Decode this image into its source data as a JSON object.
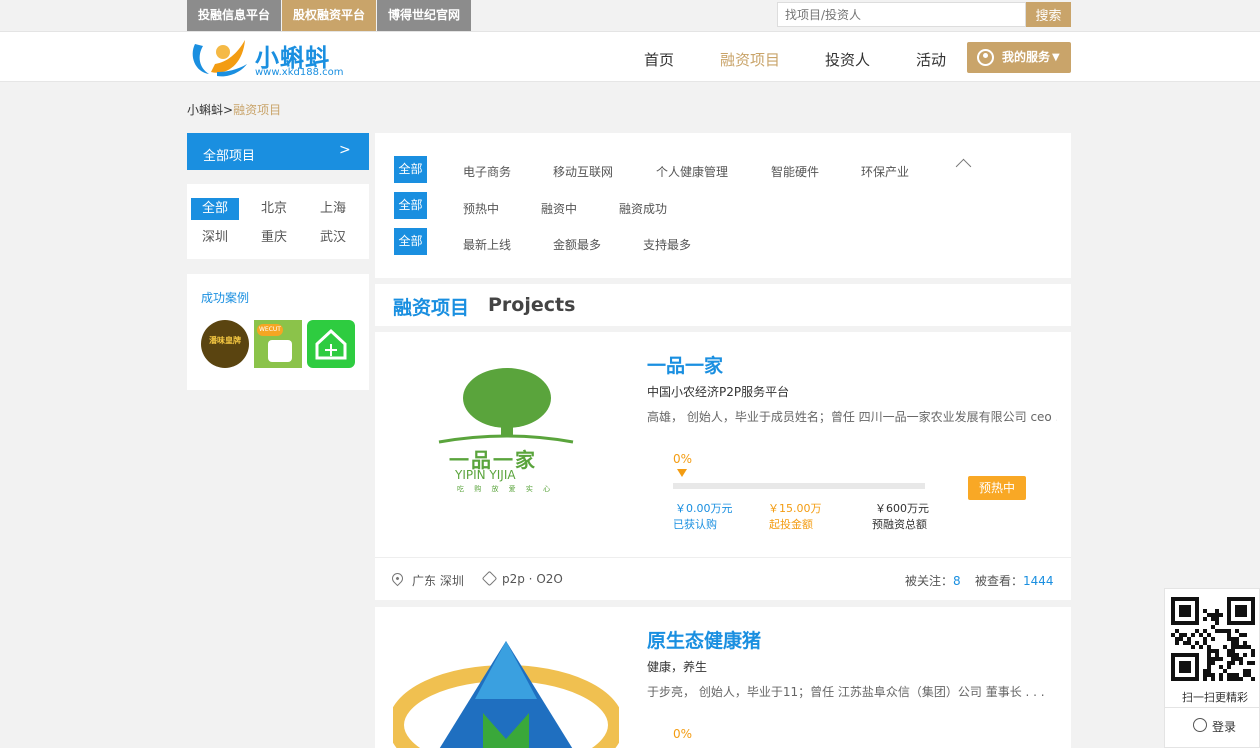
{
  "top_tabs": [
    "投融信息平台",
    "股权融资平台",
    "博得世纪官网"
  ],
  "search": {
    "placeholder": "找项目/投资人",
    "button": "搜索"
  },
  "logo": {
    "name": "小蝌蚪",
    "url": "www.xkd188.com"
  },
  "nav": {
    "items": [
      "首页",
      "融资项目",
      "投资人",
      "活动"
    ],
    "active": "融资项目",
    "service": "我的服务"
  },
  "breadcrumb": {
    "home": "小蝌蚪",
    "sep": ">",
    "current": "融资项目"
  },
  "sidebar": {
    "header": "全部项目",
    "header_arrow": ">",
    "cities": [
      "全部",
      "北京",
      "上海",
      "深圳",
      "重庆",
      "武汉"
    ],
    "cases_title": "成功案例",
    "case_logos": [
      {
        "text": "潘味皇牌"
      },
      {
        "text": "WECUT"
      },
      {
        "icon": "house-icon"
      }
    ]
  },
  "filters": {
    "all": "全部",
    "industries": [
      "电子商务",
      "移动互联网",
      "个人健康管理",
      "智能硬件",
      "环保产业"
    ],
    "stages": [
      "预热中",
      "融资中",
      "融资成功"
    ],
    "sorts": [
      "最新上线",
      "金额最多",
      "支持最多"
    ]
  },
  "section": {
    "title_cn": "融资项目",
    "title_en": "Projects"
  },
  "projects": [
    {
      "name": "一品一家",
      "tagline": "中国小农经济P2P服务平台",
      "description": "高雄， 创始人，毕业于成员姓名；曾任 四川一品一家农业发展有限公司 ceo . . .",
      "logo_text": "一品一家",
      "logo_en": "YIPIN  YIJIA",
      "logo_sub": "吃 购 放 爱 实 心",
      "progress_pct": "0%",
      "progress": 0,
      "raised": "￥0.00万元",
      "raised_label": "已获认购",
      "min_invest": "￥15.00万",
      "min_label": "起投金额",
      "target": "￥600万元",
      "target_label": "预融资总额",
      "status": "预热中",
      "location": "广东 深圳",
      "tags": "p2p · O2O",
      "follow_label": "被关注：",
      "follow": "8",
      "views_label": "被查看：",
      "views": "1444"
    },
    {
      "name": "原生态健康猪",
      "tagline": "健康，养生",
      "description": "于步亮， 创始人，毕业于11；曾任 江苏盐阜众信（集团）公司 董事长 . . .",
      "progress_pct": "0%"
    }
  ],
  "float": {
    "qr_text": "扫一扫更精彩",
    "login": "登录"
  },
  "colors": {
    "brand_blue": "#1a8fe0",
    "gold": "#c9a46a",
    "orange": "#f39c12",
    "status": "#f9a825"
  }
}
